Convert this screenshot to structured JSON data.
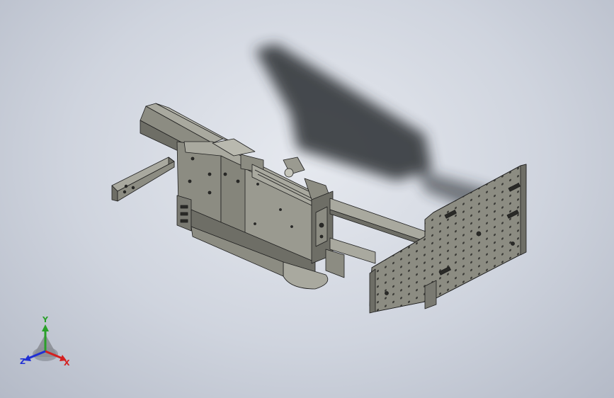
{
  "viewport": {
    "background_top": "#e6e9ef",
    "background_bottom": "#b4bac7"
  },
  "model": {
    "part_color": "#8c8c82",
    "part_light": "#a9a99f",
    "part_dark": "#5f5f58",
    "edge_color": "#1e1e1e",
    "shadow_color": "#2a2d33"
  },
  "triad": {
    "x_label": "X",
    "y_label": "Y",
    "z_label": "Z",
    "x_color": "#d42020",
    "y_color": "#2aa02a",
    "z_color": "#2030d4"
  }
}
